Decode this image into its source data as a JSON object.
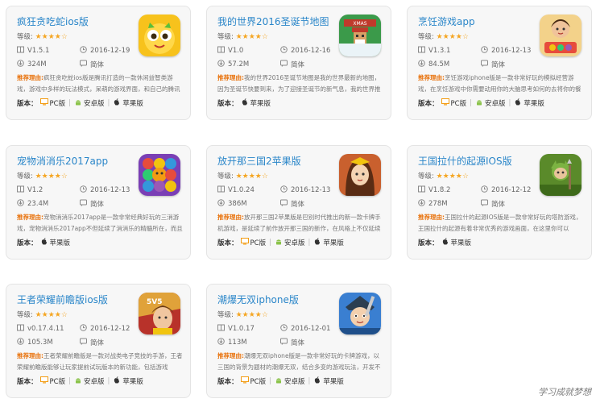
{
  "labels": {
    "rating": "等级:",
    "description": "推荐理由:",
    "versions": "版本：",
    "pc": "PC版",
    "android": "安卓版",
    "ios": "苹果版"
  },
  "cards": [
    {
      "title": "疯狂贪吃蛇ios版",
      "stars": "★★★★☆",
      "version": "V1.5.1",
      "date": "2016-12-19",
      "size": "324M",
      "language": "简体",
      "description": "疯狂贪吃蛇ios版是腾讯打造的一款休闲益智类游戏，游戏中多样的玩法模式，呆萌的游戏界面，和自己的腾讯",
      "icon": "snake-game-icon",
      "platforms": [
        "pc",
        "android",
        "ios"
      ]
    },
    {
      "title": "我的世界2016圣诞节地图",
      "stars": "★★★★☆",
      "version": "V1.0",
      "date": "2016-12-16",
      "size": "57.2M",
      "language": "简体",
      "description": "我的世界2016圣诞节地图是我的世界最新的地图，因为圣诞节快要到来，为了迎接圣诞节的新气息，我的世界推",
      "icon": "christmas-minecraft-icon",
      "platforms": [
        "ios"
      ]
    },
    {
      "title": "烹饪游戏app",
      "stars": "★★★★☆",
      "version": "V1.3.1",
      "date": "2016-12-13",
      "size": "84.5M",
      "language": "简体",
      "description": "烹饪游戏iphone版是一款非常好玩的模拟经营游戏，在烹饪游戏中你需要动用你的大脑思考如何的去将你的餐",
      "icon": "cooking-game-icon",
      "platforms": [
        "pc",
        "android",
        "ios"
      ]
    },
    {
      "title": "宠物消消乐2017app",
      "stars": "★★★★☆",
      "version": "V1.2",
      "date": "2016-12-13",
      "size": "23.4M",
      "language": "简体",
      "description": "宠物消消乐2017app是一款非常经典好玩的三消游戏，宠物消消乐2017app不但延续了消消乐的精髓所在，而且",
      "icon": "pet-match-icon",
      "platforms": [
        "ios"
      ]
    },
    {
      "title": "放开那三国2苹果版",
      "stars": "★★★★☆",
      "version": "V1.0.24",
      "date": "2016-12-13",
      "size": "386M",
      "language": "简体",
      "description": "放开那三国2苹果版是巴别时代推出的新一款卡牌手机游戏，是延续了前作放开那三国的新作，在风格上不仅延续了它",
      "icon": "three-kingdoms-icon",
      "platforms": [
        "pc",
        "android",
        "ios"
      ]
    },
    {
      "title": "王国拉什的起源IOS版",
      "stars": "★★★★☆",
      "version": "V1.8.2",
      "date": "2016-12-12",
      "size": "278M",
      "language": "简体",
      "description": "王国拉什的起源IOS版是一款非常好玩的塔防游戏，王国拉什的起源有着非常优秀的游戏画面，在这里你可以",
      "icon": "kingdom-rush-icon",
      "platforms": [
        "ios"
      ]
    },
    {
      "title": "王者荣耀前瞻版ios版",
      "stars": "★★★★☆",
      "version": "v0.17.4.11",
      "date": "2016-12-12",
      "size": "105.3M",
      "language": "简体",
      "description": "王者荣耀前瞻版是一款对战类电子竞技的手游，王者荣耀前瞻版能够让玩家提前试玩版本的新功能，包括游戏",
      "icon": "honor-of-kings-icon",
      "platforms": [
        "pc",
        "android",
        "ios"
      ]
    },
    {
      "title": "潮爆无双iphone版",
      "stars": "★★★★☆",
      "version": "V1.0.17",
      "date": "2016-12-01",
      "size": "113M",
      "language": "简体",
      "description": "潮爆无双iphone版是一款非常好玩的卡牌游戏，以三国的背景为题材的潮爆无双，结合多变的游戏玩法，开发不",
      "icon": "chaobao-wushuang-icon",
      "platforms": [
        "pc",
        "android",
        "ios"
      ]
    }
  ],
  "watermark": "学习成就梦想"
}
